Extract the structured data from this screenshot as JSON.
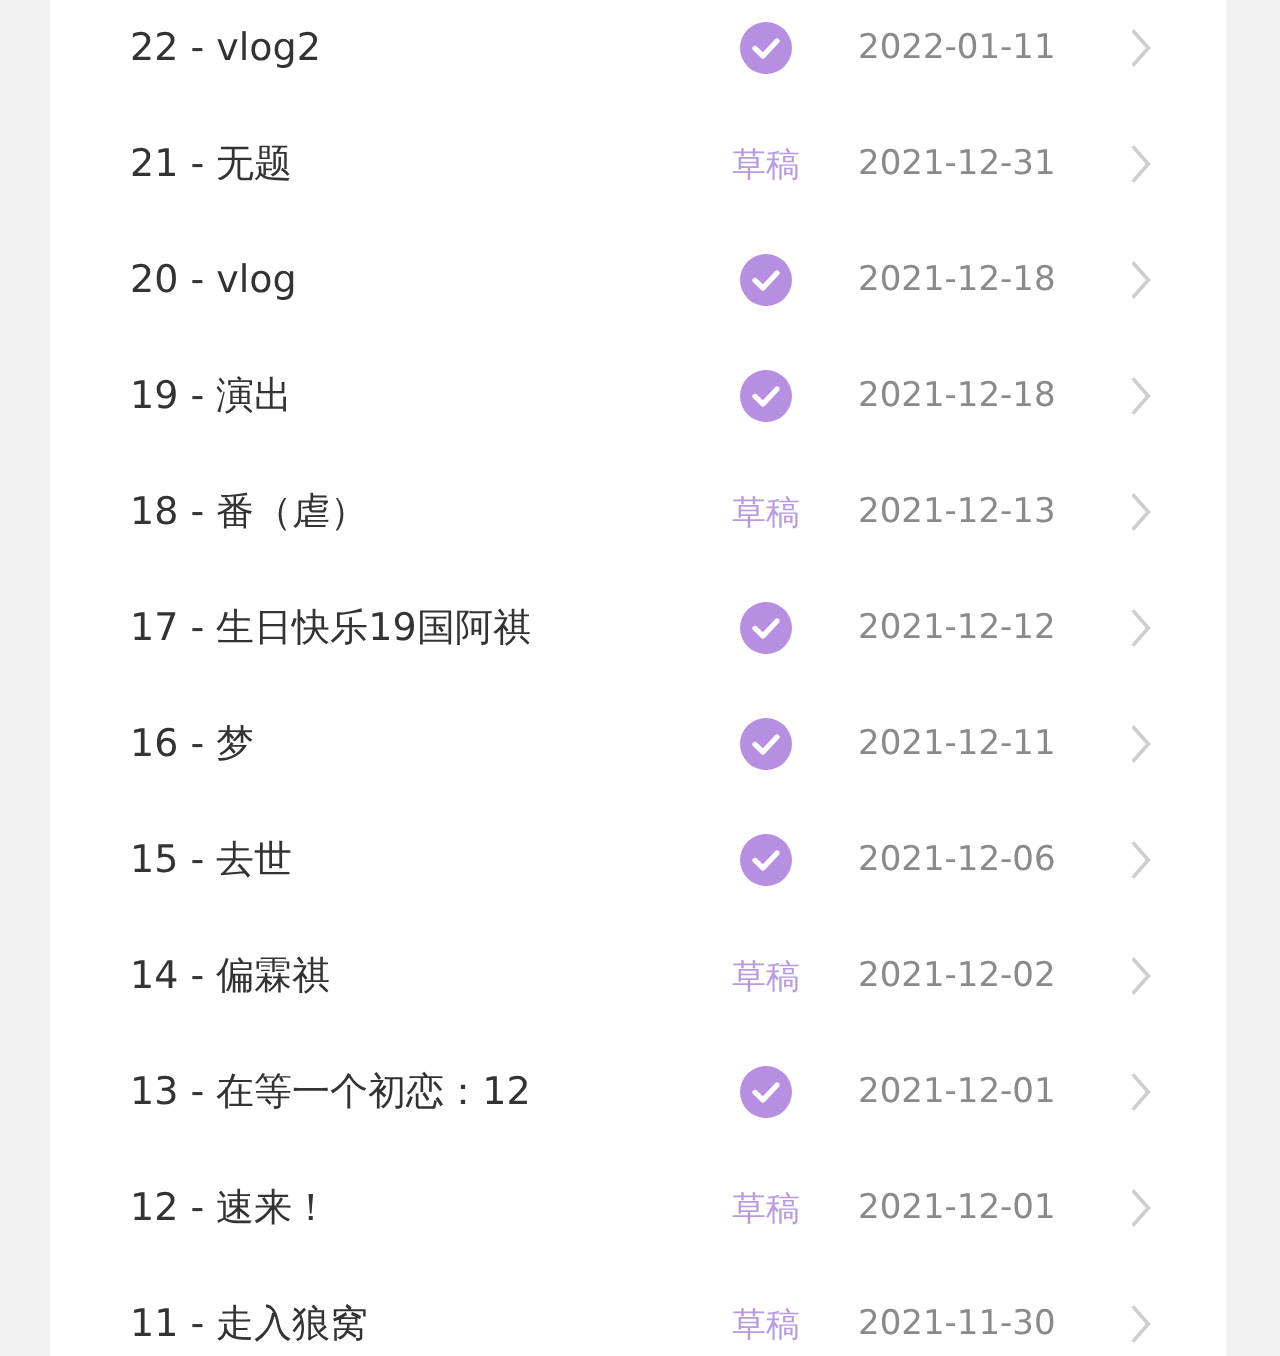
{
  "entries": [
    {
      "title": "22 - vlog2",
      "status": {
        "kind": "published"
      },
      "date": "2022-01-11"
    },
    {
      "title": "21 - 无题",
      "status": {
        "kind": "draft",
        "label": "草稿"
      },
      "date": "2021-12-31"
    },
    {
      "title": "20 - vlog",
      "status": {
        "kind": "published"
      },
      "date": "2021-12-18"
    },
    {
      "title": "19 - 演出",
      "status": {
        "kind": "published"
      },
      "date": "2021-12-18"
    },
    {
      "title": "18 - 番（虐）",
      "status": {
        "kind": "draft",
        "label": "草稿"
      },
      "date": "2021-12-13"
    },
    {
      "title": "17 - 生日快乐19国阿祺",
      "status": {
        "kind": "published"
      },
      "date": "2021-12-12"
    },
    {
      "title": "16 - 梦",
      "status": {
        "kind": "published"
      },
      "date": "2021-12-11"
    },
    {
      "title": "15 - 去世",
      "status": {
        "kind": "published"
      },
      "date": "2021-12-06"
    },
    {
      "title": "14 - 偏霖祺",
      "status": {
        "kind": "draft",
        "label": "草稿"
      },
      "date": "2021-12-02"
    },
    {
      "title": "13 - 在等一个初恋：12",
      "status": {
        "kind": "published"
      },
      "date": "2021-12-01"
    },
    {
      "title": "12 - 速来！",
      "status": {
        "kind": "draft",
        "label": "草稿"
      },
      "date": "2021-12-01"
    },
    {
      "title": "11 - 走入狼窝",
      "status": {
        "kind": "draft",
        "label": "草稿"
      },
      "date": "2021-11-30"
    }
  ]
}
